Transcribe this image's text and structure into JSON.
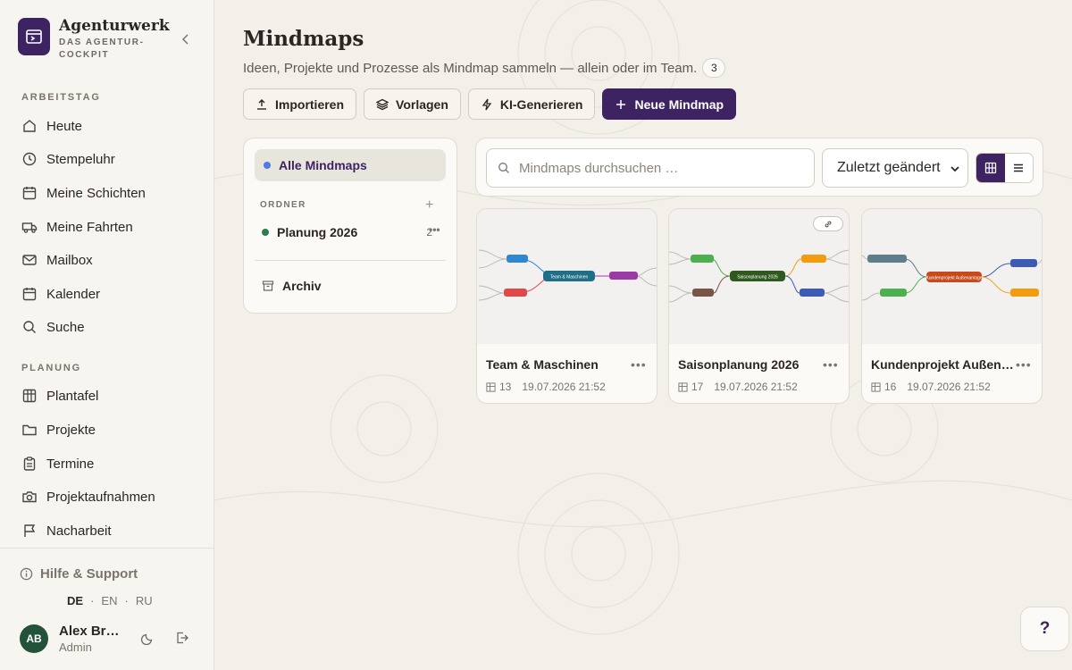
{
  "brand": {
    "name": "Agenturwerk",
    "subtitle": "DAS AGENTUR-COCKPIT"
  },
  "sidebar": {
    "section_workday": "ARBEITSTAG",
    "workday_items": [
      {
        "label": "Heute",
        "icon": "home-icon"
      },
      {
        "label": "Stempeluhr",
        "icon": "clock-icon"
      },
      {
        "label": "Meine Schichten",
        "icon": "calendar-icon"
      },
      {
        "label": "Meine Fahrten",
        "icon": "truck-icon"
      },
      {
        "label": "Mailbox",
        "icon": "mail-icon"
      },
      {
        "label": "Kalender",
        "icon": "calendar-icon"
      },
      {
        "label": "Suche",
        "icon": "search-icon"
      }
    ],
    "section_planning": "PLANUNG",
    "planning_items": [
      {
        "label": "Plantafel",
        "icon": "grid-icon"
      },
      {
        "label": "Projekte",
        "icon": "folder-icon"
      },
      {
        "label": "Termine",
        "icon": "clipboard-icon"
      },
      {
        "label": "Projektaufnahmen",
        "icon": "camera-icon"
      },
      {
        "label": "Nacharbeit",
        "icon": "flag-icon"
      }
    ],
    "help": "Hilfe & Support",
    "languages": [
      "DE",
      "EN",
      "RU"
    ],
    "active_language": "DE",
    "user": {
      "initials": "AB",
      "name": "Alex Braun",
      "role": "Admin"
    }
  },
  "page": {
    "title": "Mindmaps",
    "subtitle": "Ideen, Projekte und Prozesse als Mindmap sammeln — allein oder im Team.",
    "count": "3"
  },
  "toolbar": {
    "import": "Importieren",
    "templates": "Vorlagen",
    "ai_generate": "KI-Generieren",
    "new": "Neue Mindmap"
  },
  "folders": {
    "all": "Alle Mindmaps",
    "section": "ORDNER",
    "items": [
      {
        "label": "Planung 2026",
        "count": "2",
        "color": "#2e7d4f"
      }
    ],
    "archive": "Archiv"
  },
  "search": {
    "placeholder": "Mindmaps durchsuchen …"
  },
  "sort": {
    "selected": "Zuletzt geändert"
  },
  "cards": [
    {
      "title": "Team & Maschinen",
      "nodes": "13",
      "date": "19.07.2026 21:52",
      "center": "Team & Maschinen",
      "shared": false
    },
    {
      "title": "Saisonplanung 2026",
      "nodes": "17",
      "date": "19.07.2026 21:52",
      "center": "Saisonplanung 2026",
      "shared": true
    },
    {
      "title": "Kundenprojekt Außenanlage",
      "nodes": "16",
      "date": "19.07.2026 21:52",
      "center": "Kundenprojekt Außenanlage",
      "shared": false
    }
  ],
  "help_button": "?",
  "colors": {
    "accent": "#3e2363",
    "folder_green": "#2e7d4f",
    "all_dot": "#4f7be8"
  }
}
